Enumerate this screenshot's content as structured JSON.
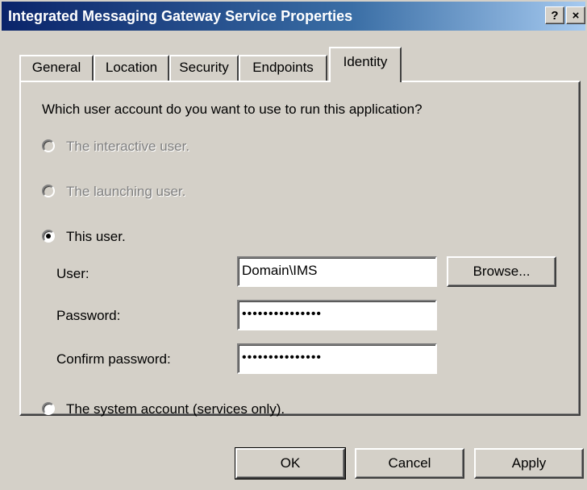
{
  "window": {
    "title": "Integrated Messaging Gateway Service Properties",
    "help_label": "?",
    "close_label": "×"
  },
  "tabs": [
    {
      "label": "General"
    },
    {
      "label": "Location"
    },
    {
      "label": "Security"
    },
    {
      "label": "Endpoints"
    },
    {
      "label": "Identity",
      "active": true
    }
  ],
  "identity": {
    "question": "Which user account do you want to use to run this application?",
    "options": [
      {
        "label": "The interactive user.",
        "enabled": false,
        "selected": false
      },
      {
        "label": "The launching user.",
        "enabled": false,
        "selected": false
      },
      {
        "label": "This user.",
        "enabled": true,
        "selected": true
      },
      {
        "label": "The system account (services only).",
        "enabled": true,
        "selected": false
      }
    ],
    "user_label": "User:",
    "user_value": "Domain\\IMS",
    "password_label": "Password:",
    "password_value": "•••••••••••••••",
    "confirm_label": "Confirm password:",
    "confirm_value": "•••••••••••••••",
    "browse_label": "Browse..."
  },
  "buttons": {
    "ok": "OK",
    "cancel": "Cancel",
    "apply": "Apply"
  }
}
